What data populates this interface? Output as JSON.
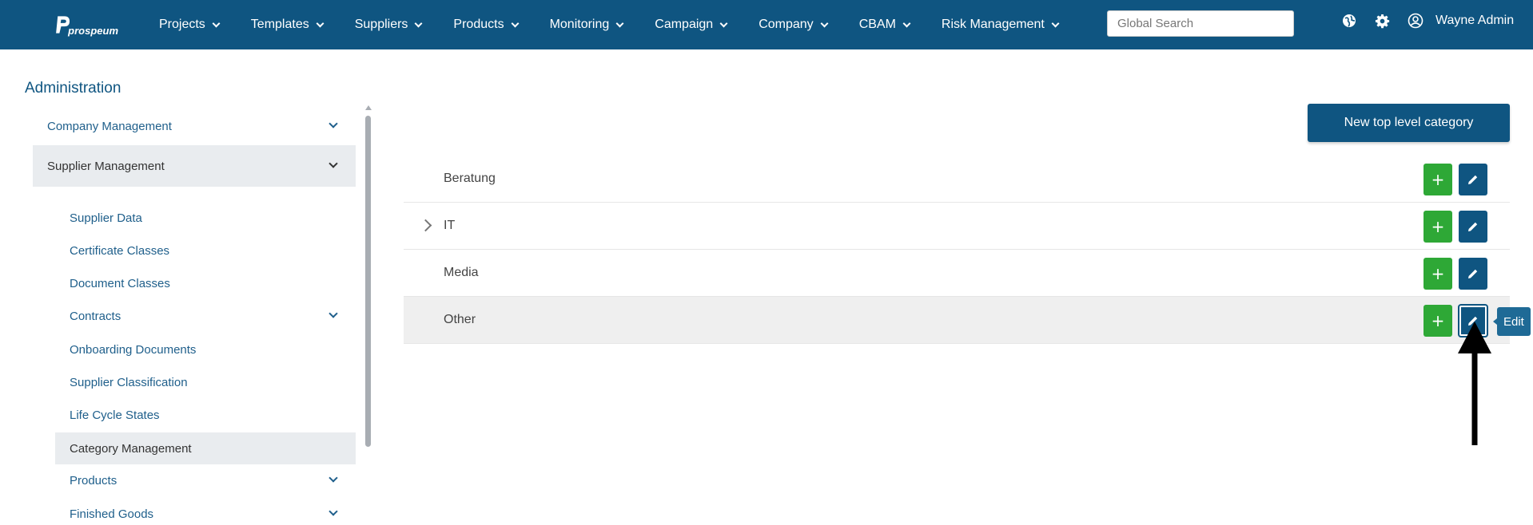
{
  "brand": {
    "name": "prospeum"
  },
  "nav": {
    "items": [
      {
        "label": "Projects"
      },
      {
        "label": "Templates"
      },
      {
        "label": "Suppliers"
      },
      {
        "label": "Products"
      },
      {
        "label": "Monitoring"
      },
      {
        "label": "Campaign"
      },
      {
        "label": "Company"
      },
      {
        "label": "CBAM"
      },
      {
        "label": "Risk Management"
      }
    ],
    "search_placeholder": "Global Search",
    "user_name": "Wayne Admin"
  },
  "sidebar": {
    "title": "Administration",
    "items": [
      {
        "label": "Company Management"
      },
      {
        "label": "Supplier Management"
      },
      {
        "label": "Supplier Data"
      },
      {
        "label": "Certificate Classes"
      },
      {
        "label": "Document Classes"
      },
      {
        "label": "Contracts"
      },
      {
        "label": "Onboarding Documents"
      },
      {
        "label": "Supplier Classification"
      },
      {
        "label": "Life Cycle States"
      },
      {
        "label": "Category Management"
      },
      {
        "label": "Products"
      },
      {
        "label": "Finished Goods"
      }
    ]
  },
  "main": {
    "new_button_label": "New top level category",
    "categories": [
      {
        "label": "Beratung"
      },
      {
        "label": "IT"
      },
      {
        "label": "Media"
      },
      {
        "label": "Other"
      }
    ],
    "add_label": "+",
    "tooltip": "Edit"
  },
  "colors": {
    "brand": "#0f5581",
    "add": "#2ea836",
    "active_bg": "#e9ecef"
  }
}
